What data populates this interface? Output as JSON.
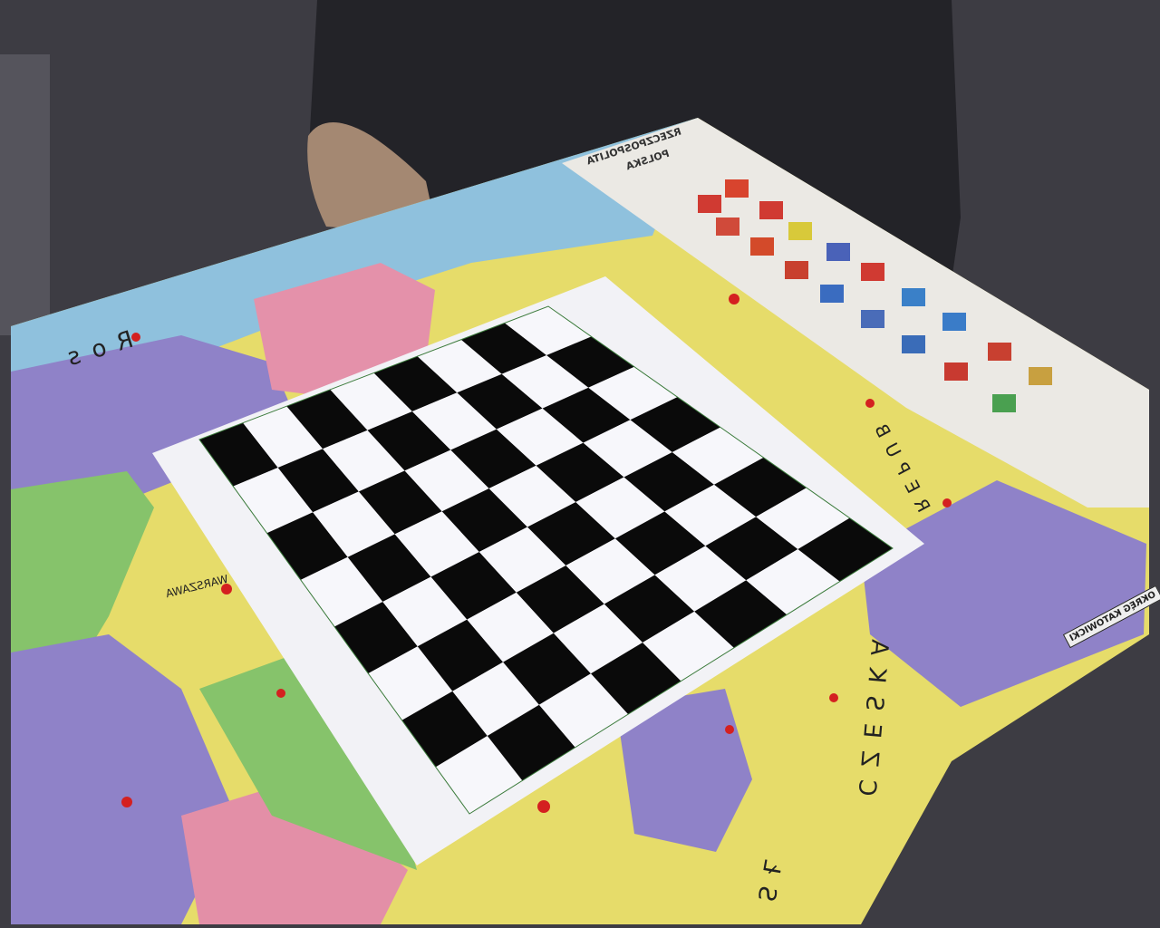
{
  "map_labels": {
    "country_north": "Ros",
    "country_east_upper": "REPUB",
    "country_east_lower": "CZESKA",
    "country_south": "SŁ",
    "capital": "WARSZAWA",
    "title_line1": "RZECZPOSPOLITA",
    "title_line2": "POLSKA",
    "inset_box": "OKRĘG KATOWICKI"
  },
  "colors": {
    "background": "#3a3940",
    "shirt": "#26262b",
    "skin": "#a88a74",
    "map_blue": "#8fc1dd",
    "map_yellow": "#e8df6a",
    "map_purple": "#8d7fc7",
    "map_pink": "#e590a8",
    "map_green": "#8cc46c",
    "board_paper": "#f2f2f6",
    "square_dark": "#0a0a0a",
    "square_light": "#f7f7fb"
  }
}
